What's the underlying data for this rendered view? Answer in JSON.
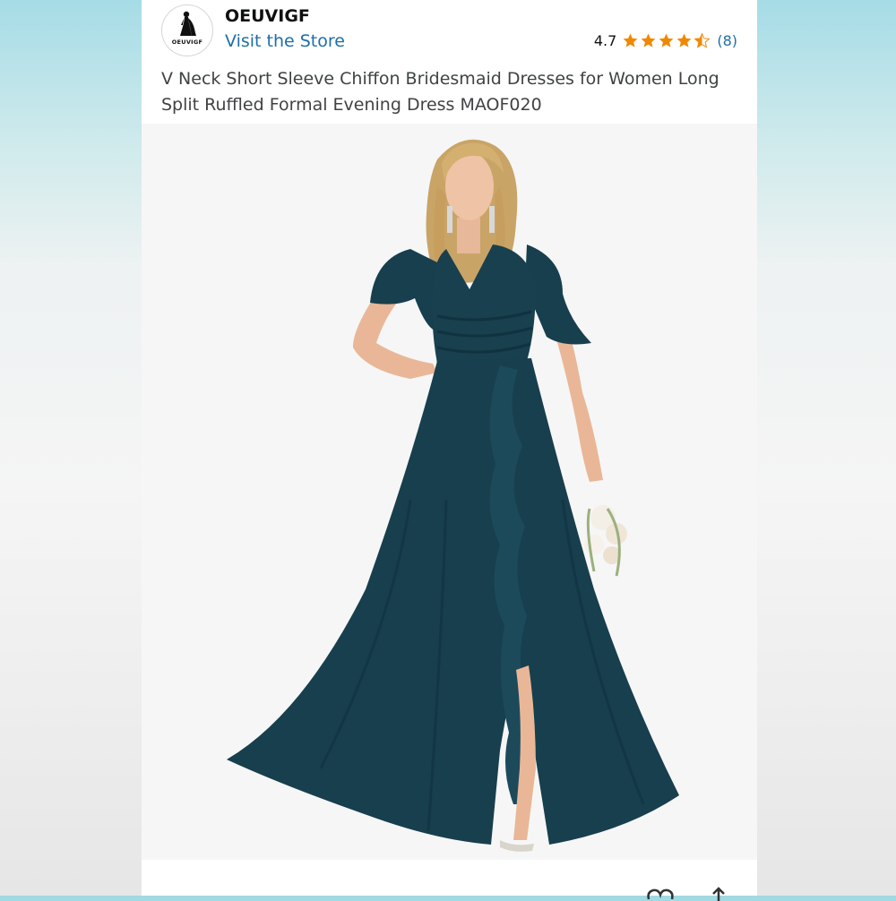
{
  "seller": {
    "logo_text": "OEUVIGF",
    "name": "OEUVIGF",
    "store_link_label": "Visit the Store"
  },
  "rating": {
    "value": "4.7",
    "stars_filled": 4.5,
    "count_label": "(8)",
    "star_color": "#f08804"
  },
  "product": {
    "title": "V Neck Short Sleeve Chiffon Bridesmaid Dresses for Women Long Split Ruffled Formal Evening Dress MAOF020",
    "dress_color": "#17404f"
  },
  "actions": {
    "favorite_icon": "heart-icon",
    "share_icon": "share-icon"
  }
}
